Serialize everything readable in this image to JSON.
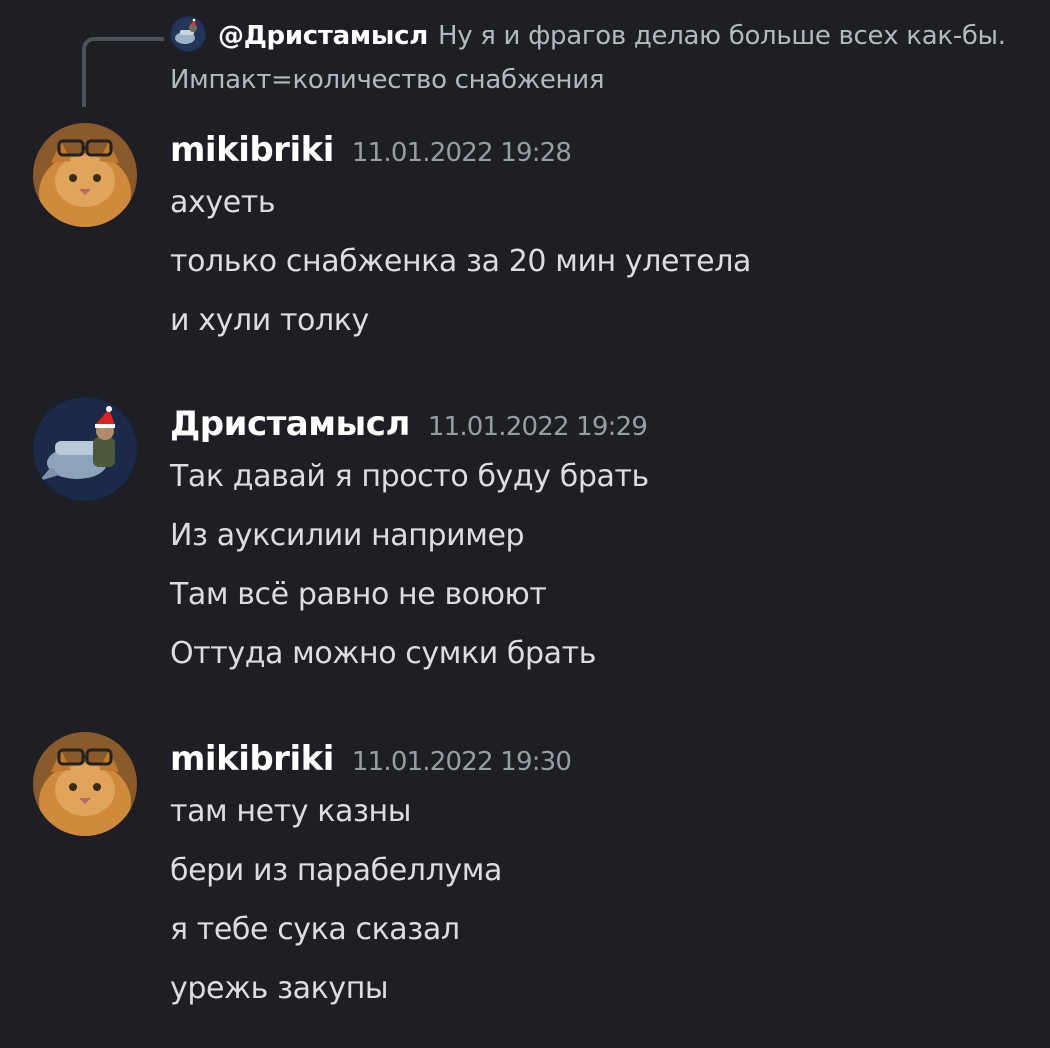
{
  "reply": {
    "author": "@Дристамысл",
    "text": "Ну я и фрагов делаю больше всех как-бы.",
    "text_cont": "Импакт=количество снабжения",
    "avatar_icon": "pilot-avatar-icon"
  },
  "messages": [
    {
      "author": "mikibriki",
      "timestamp": "11.01.2022 19:28",
      "avatar_icon": "cat-with-glasses-avatar-icon",
      "lines": [
        "ахуеть",
        "только снабженка за 20 мин улетела",
        "и хули толку"
      ]
    },
    {
      "author": "Дристамысл",
      "timestamp": "11.01.2022 19:29",
      "avatar_icon": "pilot-avatar-icon",
      "lines": [
        "Так давай я просто буду брать",
        "Из ауксилии например",
        "Там всё равно не воюют",
        "Оттуда можно сумки брать"
      ]
    },
    {
      "author": "mikibriki",
      "timestamp": "11.01.2022 19:30",
      "avatar_icon": "cat-with-glasses-avatar-icon",
      "lines": [
        "там нету казны",
        "бери из парабеллума",
        "я тебе сука сказал",
        "урежь закупы"
      ]
    }
  ],
  "colors": {
    "background": "#1e1f24",
    "author": "#ffffff",
    "message": "#dcdde1",
    "timestamp": "#9a9ca4",
    "reply_spine": "#4e5058"
  }
}
